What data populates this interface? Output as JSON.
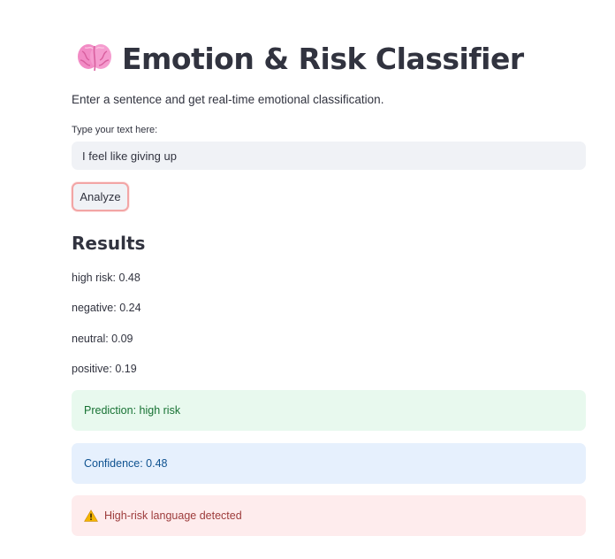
{
  "header": {
    "title": "Emotion & Risk Classifier",
    "icon": "brain-icon",
    "subtitle": "Enter a sentence and get real-time emotional classification."
  },
  "input": {
    "label": "Type your text here:",
    "value": "I feel like giving up"
  },
  "analyze_button": {
    "label": "Analyze"
  },
  "results": {
    "heading": "Results",
    "scores": [
      {
        "text": "high risk: 0.48"
      },
      {
        "text": "negative: 0.24"
      },
      {
        "text": "neutral: 0.09"
      },
      {
        "text": "positive: 0.19"
      }
    ]
  },
  "alerts": {
    "prediction": "Prediction: high risk",
    "confidence": "Confidence: 0.48",
    "warning": "High-risk language detected",
    "warning_icon": "warning-icon"
  },
  "colors": {
    "success_bg": "#e8f9ee",
    "success_text": "#177233",
    "info_bg": "#e6f0fd",
    "info_text": "#0f5290",
    "error_bg": "#feeced",
    "error_text": "#9d3b3b",
    "button_focus_border": "#f2a5a5"
  }
}
